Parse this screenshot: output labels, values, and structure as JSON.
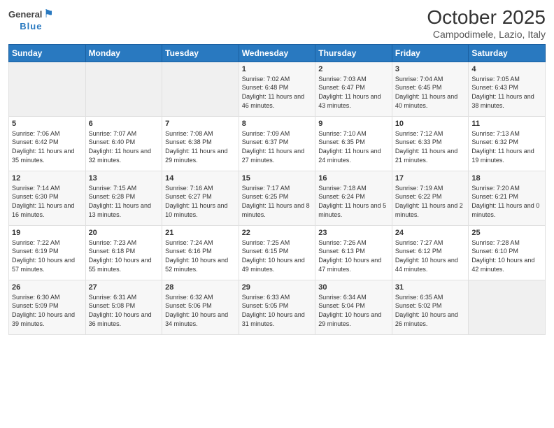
{
  "logo": {
    "general": "General",
    "blue": "Blue"
  },
  "title": "October 2025",
  "location": "Campodimele, Lazio, Italy",
  "weekdays": [
    "Sunday",
    "Monday",
    "Tuesday",
    "Wednesday",
    "Thursday",
    "Friday",
    "Saturday"
  ],
  "weeks": [
    [
      {
        "day": "",
        "empty": true
      },
      {
        "day": "",
        "empty": true
      },
      {
        "day": "",
        "empty": true
      },
      {
        "day": "1",
        "sunrise": "7:02 AM",
        "sunset": "6:48 PM",
        "daylight": "11 hours and 46 minutes."
      },
      {
        "day": "2",
        "sunrise": "7:03 AM",
        "sunset": "6:47 PM",
        "daylight": "11 hours and 43 minutes."
      },
      {
        "day": "3",
        "sunrise": "7:04 AM",
        "sunset": "6:45 PM",
        "daylight": "11 hours and 40 minutes."
      },
      {
        "day": "4",
        "sunrise": "7:05 AM",
        "sunset": "6:43 PM",
        "daylight": "11 hours and 38 minutes."
      }
    ],
    [
      {
        "day": "5",
        "sunrise": "7:06 AM",
        "sunset": "6:42 PM",
        "daylight": "11 hours and 35 minutes."
      },
      {
        "day": "6",
        "sunrise": "7:07 AM",
        "sunset": "6:40 PM",
        "daylight": "11 hours and 32 minutes."
      },
      {
        "day": "7",
        "sunrise": "7:08 AM",
        "sunset": "6:38 PM",
        "daylight": "11 hours and 29 minutes."
      },
      {
        "day": "8",
        "sunrise": "7:09 AM",
        "sunset": "6:37 PM",
        "daylight": "11 hours and 27 minutes."
      },
      {
        "day": "9",
        "sunrise": "7:10 AM",
        "sunset": "6:35 PM",
        "daylight": "11 hours and 24 minutes."
      },
      {
        "day": "10",
        "sunrise": "7:12 AM",
        "sunset": "6:33 PM",
        "daylight": "11 hours and 21 minutes."
      },
      {
        "day": "11",
        "sunrise": "7:13 AM",
        "sunset": "6:32 PM",
        "daylight": "11 hours and 19 minutes."
      }
    ],
    [
      {
        "day": "12",
        "sunrise": "7:14 AM",
        "sunset": "6:30 PM",
        "daylight": "11 hours and 16 minutes."
      },
      {
        "day": "13",
        "sunrise": "7:15 AM",
        "sunset": "6:28 PM",
        "daylight": "11 hours and 13 minutes."
      },
      {
        "day": "14",
        "sunrise": "7:16 AM",
        "sunset": "6:27 PM",
        "daylight": "11 hours and 10 minutes."
      },
      {
        "day": "15",
        "sunrise": "7:17 AM",
        "sunset": "6:25 PM",
        "daylight": "11 hours and 8 minutes."
      },
      {
        "day": "16",
        "sunrise": "7:18 AM",
        "sunset": "6:24 PM",
        "daylight": "11 hours and 5 minutes."
      },
      {
        "day": "17",
        "sunrise": "7:19 AM",
        "sunset": "6:22 PM",
        "daylight": "11 hours and 2 minutes."
      },
      {
        "day": "18",
        "sunrise": "7:20 AM",
        "sunset": "6:21 PM",
        "daylight": "11 hours and 0 minutes."
      }
    ],
    [
      {
        "day": "19",
        "sunrise": "7:22 AM",
        "sunset": "6:19 PM",
        "daylight": "10 hours and 57 minutes."
      },
      {
        "day": "20",
        "sunrise": "7:23 AM",
        "sunset": "6:18 PM",
        "daylight": "10 hours and 55 minutes."
      },
      {
        "day": "21",
        "sunrise": "7:24 AM",
        "sunset": "6:16 PM",
        "daylight": "10 hours and 52 minutes."
      },
      {
        "day": "22",
        "sunrise": "7:25 AM",
        "sunset": "6:15 PM",
        "daylight": "10 hours and 49 minutes."
      },
      {
        "day": "23",
        "sunrise": "7:26 AM",
        "sunset": "6:13 PM",
        "daylight": "10 hours and 47 minutes."
      },
      {
        "day": "24",
        "sunrise": "7:27 AM",
        "sunset": "6:12 PM",
        "daylight": "10 hours and 44 minutes."
      },
      {
        "day": "25",
        "sunrise": "7:28 AM",
        "sunset": "6:10 PM",
        "daylight": "10 hours and 42 minutes."
      }
    ],
    [
      {
        "day": "26",
        "sunrise": "6:30 AM",
        "sunset": "5:09 PM",
        "daylight": "10 hours and 39 minutes."
      },
      {
        "day": "27",
        "sunrise": "6:31 AM",
        "sunset": "5:08 PM",
        "daylight": "10 hours and 36 minutes."
      },
      {
        "day": "28",
        "sunrise": "6:32 AM",
        "sunset": "5:06 PM",
        "daylight": "10 hours and 34 minutes."
      },
      {
        "day": "29",
        "sunrise": "6:33 AM",
        "sunset": "5:05 PM",
        "daylight": "10 hours and 31 minutes."
      },
      {
        "day": "30",
        "sunrise": "6:34 AM",
        "sunset": "5:04 PM",
        "daylight": "10 hours and 29 minutes."
      },
      {
        "day": "31",
        "sunrise": "6:35 AM",
        "sunset": "5:02 PM",
        "daylight": "10 hours and 26 minutes."
      },
      {
        "day": "",
        "empty": true
      }
    ]
  ]
}
